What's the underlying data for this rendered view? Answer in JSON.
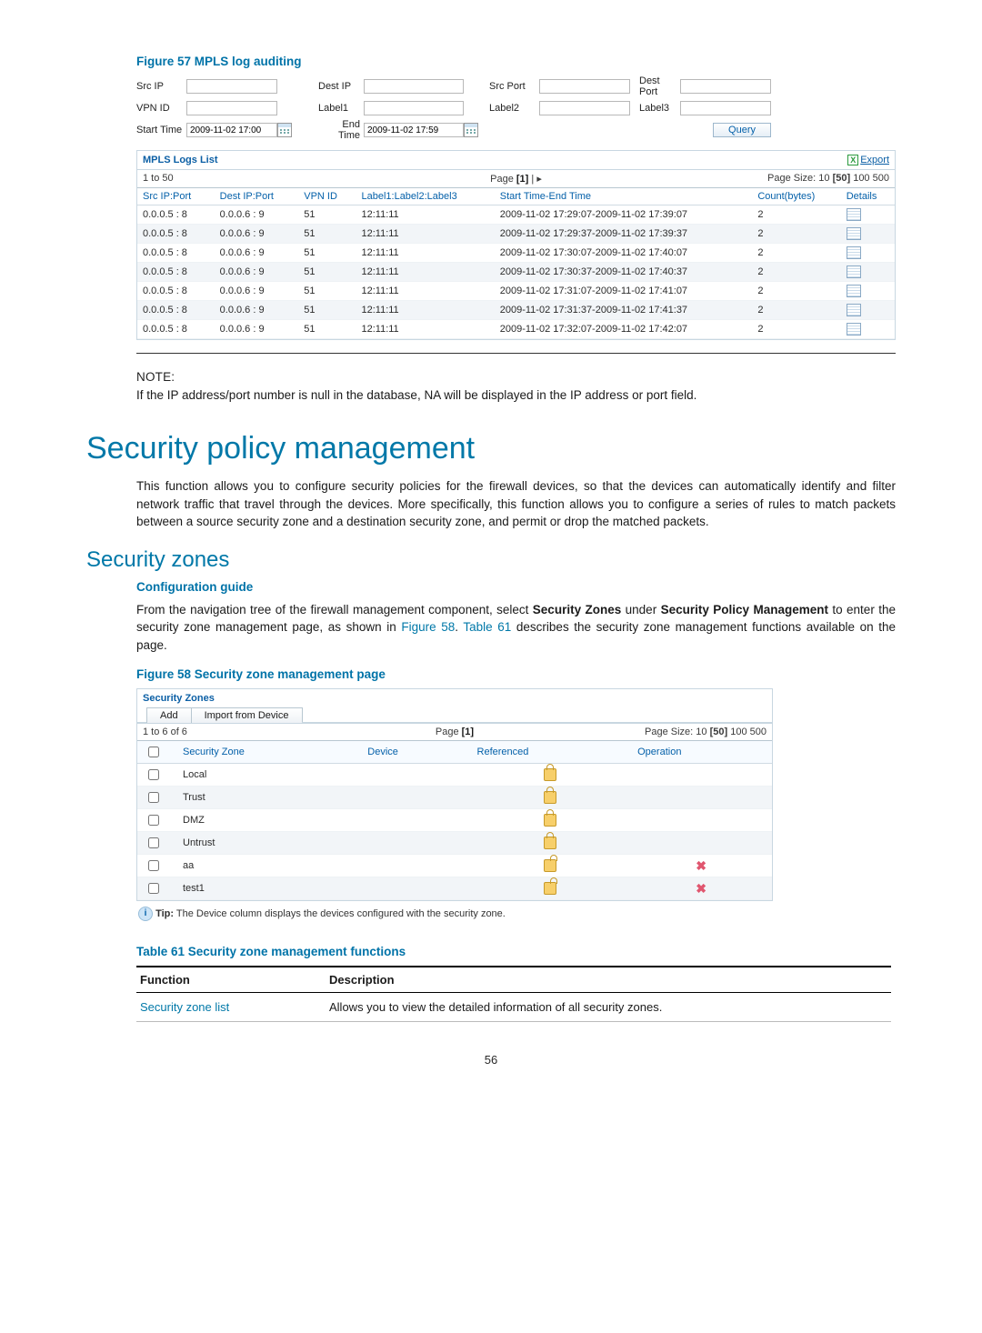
{
  "figures": {
    "f57": "Figure 57 MPLS log auditing",
    "f58": "Figure 58 Security zone management page"
  },
  "filter": {
    "labels": {
      "src_ip": "Src IP",
      "dest_ip": "Dest IP",
      "src_port": "Src Port",
      "dest_port": "Dest Port",
      "vpn_id": "VPN ID",
      "label1": "Label1",
      "label2": "Label2",
      "label3": "Label3",
      "start_time": "Start Time",
      "end_time": "End Time"
    },
    "values": {
      "start_time": "2009-11-02 17:00",
      "end_time": "2009-11-02 17:59"
    },
    "query": "Query"
  },
  "mpls": {
    "panel_title": "MPLS Logs List",
    "export": "Export",
    "pager": {
      "range": "1 to 50",
      "page_prefix": "Page",
      "page_list": "[1]",
      "page_size_prefix": "Page Size:",
      "sizes": [
        "10",
        "[50]",
        "100",
        "500"
      ]
    },
    "cols": [
      "Src IP:Port",
      "Dest IP:Port",
      "VPN ID",
      "Label1:Label2:Label3",
      "Start Time-End Time",
      "Count(bytes)",
      "Details"
    ],
    "rows": [
      {
        "src": "0.0.0.5 : 8",
        "dst": "0.0.0.6 : 9",
        "vpn": "51",
        "lab": "12:11:11",
        "time": "2009-11-02 17:29:07-2009-11-02 17:39:07",
        "cnt": "2"
      },
      {
        "src": "0.0.0.5 : 8",
        "dst": "0.0.0.6 : 9",
        "vpn": "51",
        "lab": "12:11:11",
        "time": "2009-11-02 17:29:37-2009-11-02 17:39:37",
        "cnt": "2"
      },
      {
        "src": "0.0.0.5 : 8",
        "dst": "0.0.0.6 : 9",
        "vpn": "51",
        "lab": "12:11:11",
        "time": "2009-11-02 17:30:07-2009-11-02 17:40:07",
        "cnt": "2"
      },
      {
        "src": "0.0.0.5 : 8",
        "dst": "0.0.0.6 : 9",
        "vpn": "51",
        "lab": "12:11:11",
        "time": "2009-11-02 17:30:37-2009-11-02 17:40:37",
        "cnt": "2"
      },
      {
        "src": "0.0.0.5 : 8",
        "dst": "0.0.0.6 : 9",
        "vpn": "51",
        "lab": "12:11:11",
        "time": "2009-11-02 17:31:07-2009-11-02 17:41:07",
        "cnt": "2"
      },
      {
        "src": "0.0.0.5 : 8",
        "dst": "0.0.0.6 : 9",
        "vpn": "51",
        "lab": "12:11:11",
        "time": "2009-11-02 17:31:37-2009-11-02 17:41:37",
        "cnt": "2"
      },
      {
        "src": "0.0.0.5 : 8",
        "dst": "0.0.0.6 : 9",
        "vpn": "51",
        "lab": "12:11:11",
        "time": "2009-11-02 17:32:07-2009-11-02 17:42:07",
        "cnt": "2"
      }
    ]
  },
  "note": {
    "heading": "NOTE:",
    "text": "If the IP address/port number is null in the database, NA will be displayed in the IP address or port field."
  },
  "headings": {
    "h1": "Security policy management",
    "h2": "Security zones",
    "h3": "Configuration guide"
  },
  "paras": {
    "spm": "This function allows you to configure security policies for the firewall devices, so that the devices can automatically identify and filter network traffic that travel through the devices. More specifically, this function allows you to configure a series of rules to match packets between a source security zone and a destination security zone, and permit or drop the matched packets.",
    "cfg_pre": "From the navigation tree of the firewall management component, select ",
    "cfg_b1": "Security Zones",
    "cfg_mid1": " under ",
    "cfg_b2": "Security Policy Management",
    "cfg_mid2": " to enter the security zone management page, as shown in ",
    "cfg_link1": "Figure 58",
    "cfg_mid3": ". ",
    "cfg_link2": "Table 61",
    "cfg_post": " describes the security zone management functions available on the page."
  },
  "sz": {
    "panel_title": "Security Zones",
    "buttons": {
      "add": "Add",
      "import": "Import from Device"
    },
    "pager": {
      "range": "1 to 6 of 6",
      "page_prefix": "Page",
      "page_list": "[1]",
      "page_size_prefix": "Page Size:",
      "sizes": [
        "10",
        "[50]",
        "100",
        "500"
      ]
    },
    "cols": [
      "",
      "Security Zone",
      "Device",
      "Referenced",
      "Operation"
    ],
    "rows": [
      {
        "name": "Local",
        "locked": true,
        "deletable": false
      },
      {
        "name": "Trust",
        "locked": true,
        "deletable": false
      },
      {
        "name": "DMZ",
        "locked": true,
        "deletable": false
      },
      {
        "name": "Untrust",
        "locked": true,
        "deletable": false
      },
      {
        "name": "aa",
        "locked": false,
        "deletable": true
      },
      {
        "name": "test1",
        "locked": false,
        "deletable": true
      }
    ],
    "tip_prefix": "Tip:",
    "tip_text": " The Device column displays the devices configured with the security zone."
  },
  "table61": {
    "caption": "Table 61 Security zone management functions",
    "head": [
      "Function",
      "Description"
    ],
    "rows": [
      {
        "func": "Security zone list",
        "func_link": true,
        "desc": "Allows you to view the detailed information of all security zones."
      }
    ]
  },
  "page_number": "56"
}
